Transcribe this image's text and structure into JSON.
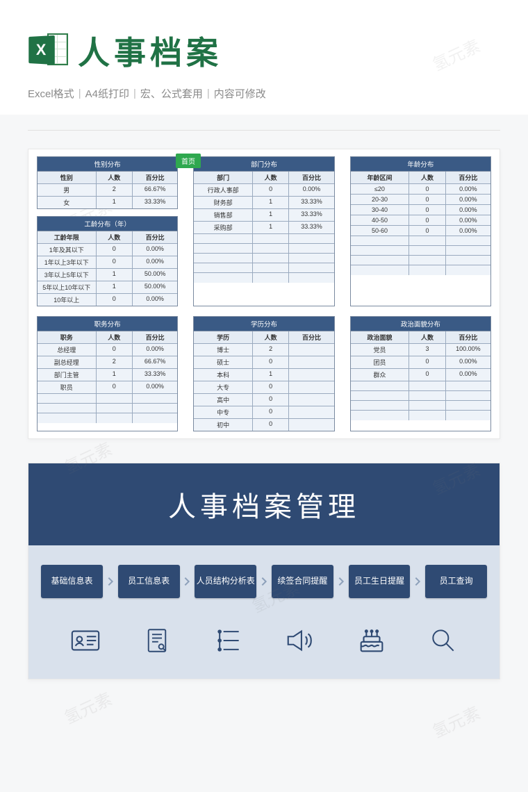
{
  "watermark": "氢元素",
  "header": {
    "icon_letter": "X",
    "title": "人事档案",
    "sub1": "Excel格式",
    "sub2": "A4纸打印",
    "sub3": "宏、公式套用",
    "sub4": "内容可修改"
  },
  "badge": "首页",
  "tables": {
    "gender": {
      "title": "性别分布",
      "headers": [
        "性别",
        "人数",
        "百分比"
      ],
      "rows": [
        [
          "男",
          "2",
          "66.67%"
        ],
        [
          "女",
          "1",
          "33.33%"
        ]
      ]
    },
    "tenure": {
      "title": "工龄分布（年）",
      "headers": [
        "工龄年限",
        "人数",
        "百分比"
      ],
      "rows": [
        [
          "1年及其以下",
          "0",
          "0.00%"
        ],
        [
          "1年以上3年以下",
          "0",
          "0.00%"
        ],
        [
          "3年以上5年以下",
          "1",
          "50.00%"
        ],
        [
          "5年以上10年以下",
          "1",
          "50.00%"
        ],
        [
          "10年以上",
          "0",
          "0.00%"
        ]
      ]
    },
    "dept": {
      "title": "部门分布",
      "headers": [
        "部门",
        "人数",
        "百分比"
      ],
      "rows": [
        [
          "行政人事部",
          "0",
          "0.00%"
        ],
        [
          "财务部",
          "1",
          "33.33%"
        ],
        [
          "销售部",
          "1",
          "33.33%"
        ],
        [
          "采购部",
          "1",
          "33.33%"
        ],
        [
          "",
          "",
          ""
        ],
        [
          "",
          "",
          ""
        ],
        [
          "",
          "",
          ""
        ],
        [
          "",
          "",
          ""
        ],
        [
          "",
          "",
          ""
        ]
      ]
    },
    "age": {
      "title": "年龄分布",
      "headers": [
        "年龄区间",
        "人数",
        "百分比"
      ],
      "rows": [
        [
          "≤20",
          "0",
          "0.00%"
        ],
        [
          "20-30",
          "0",
          "0.00%"
        ],
        [
          "30-40",
          "0",
          "0.00%"
        ],
        [
          "40-50",
          "0",
          "0.00%"
        ],
        [
          "50-60",
          "0",
          "0.00%"
        ],
        [
          "",
          "",
          ""
        ],
        [
          "",
          "",
          ""
        ],
        [
          "",
          "",
          ""
        ],
        [
          "",
          "",
          ""
        ]
      ]
    },
    "position": {
      "title": "职务分布",
      "headers": [
        "职务",
        "人数",
        "百分比"
      ],
      "rows": [
        [
          "总经理",
          "0",
          "0.00%"
        ],
        [
          "副总经理",
          "2",
          "66.67%"
        ],
        [
          "部门主管",
          "1",
          "33.33%"
        ],
        [
          "职员",
          "0",
          "0.00%"
        ],
        [
          "",
          "",
          ""
        ],
        [
          "",
          "",
          ""
        ],
        [
          "",
          "",
          ""
        ]
      ]
    },
    "edu": {
      "title": "学历分布",
      "headers": [
        "学历",
        "人数",
        "百分比"
      ],
      "rows": [
        [
          "博士",
          "2",
          ""
        ],
        [
          "硕士",
          "0",
          ""
        ],
        [
          "本科",
          "1",
          ""
        ],
        [
          "大专",
          "0",
          ""
        ],
        [
          "高中",
          "0",
          ""
        ],
        [
          "中专",
          "0",
          ""
        ],
        [
          "初中",
          "0",
          ""
        ]
      ]
    },
    "political": {
      "title": "政治面貌分布",
      "headers": [
        "政治面貌",
        "人数",
        "百分比"
      ],
      "rows": [
        [
          "党员",
          "3",
          "100.00%"
        ],
        [
          "团员",
          "0",
          "0.00%"
        ],
        [
          "群众",
          "0",
          "0.00%"
        ],
        [
          "",
          "",
          ""
        ],
        [
          "",
          "",
          ""
        ],
        [
          "",
          "",
          ""
        ],
        [
          "",
          "",
          ""
        ]
      ]
    }
  },
  "panel": {
    "title": "人事档案管理",
    "flow": [
      "基础信息表",
      "员工信息表",
      "人员结构分析表",
      "续签合同提醒",
      "员工生日提醒",
      "员工查询"
    ],
    "icons": [
      "id-card-icon",
      "document-icon",
      "list-icon",
      "speaker-icon",
      "cake-icon",
      "search-icon"
    ]
  }
}
